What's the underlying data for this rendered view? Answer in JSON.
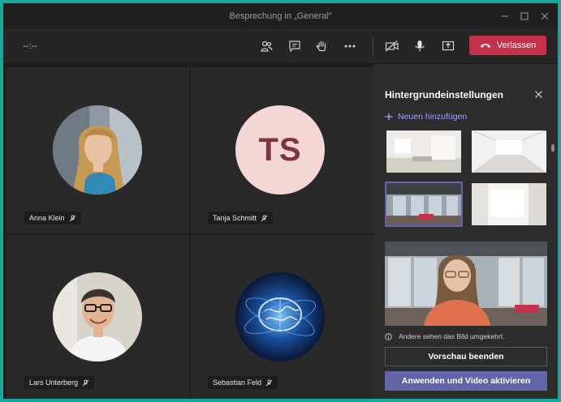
{
  "window": {
    "title": "Besprechung in „General“"
  },
  "toolbar": {
    "timer": "--:--",
    "leave_label": "Verlassen",
    "icons": [
      "participants-icon",
      "chat-icon",
      "raise-hand-icon",
      "more-options-icon",
      "camera-off-icon",
      "microphone-icon",
      "share-screen-icon",
      "phone-hangup-icon"
    ]
  },
  "participants": [
    {
      "name": "Anna Klein",
      "avatar": "photo"
    },
    {
      "name": "Tanja Schmitt",
      "avatar": "initials",
      "initials": "TS"
    },
    {
      "name": "Lars Unterberg",
      "avatar": "photo"
    },
    {
      "name": "Sebastian Feld",
      "avatar": "image"
    }
  ],
  "panel": {
    "title": "Hintergrundeinstellungen",
    "add_new": "Neuen hinzufügen",
    "info": "Andere sehen das Bild umgekehrt.",
    "preview_button": "Vorschau beenden",
    "apply_button": "Anwenden und Video aktivieren"
  },
  "colors": {
    "accent": "#6264a7",
    "leave": "#c4314b",
    "frame": "#16a89a",
    "avatar_initials_bg": "#f4d6d5",
    "avatar_initials_fg": "#7d3640"
  }
}
